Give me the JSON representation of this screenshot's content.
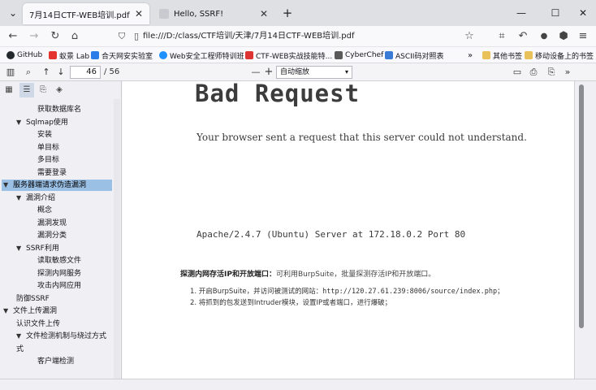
{
  "tabs": [
    {
      "title": "7月14日CTF-WEB培训.pdf",
      "active": true
    },
    {
      "title": "Hello, SSRF!",
      "active": false
    }
  ],
  "new_tab": "+",
  "window_controls": {
    "minimize": "—",
    "maximize": "☐",
    "close": "✕",
    "list": "⌄"
  },
  "navbar": {
    "url": "file:///D:/class/CTF培训/天津/7月14日CTF-WEB培训.pdf"
  },
  "bookmarks": [
    {
      "label": "GitHub",
      "icon": "github-icon",
      "color": "#24292e"
    },
    {
      "label": "蚁景 Lab",
      "icon": "ant-icon",
      "color": "#e3342f"
    },
    {
      "label": "合天网安实验室",
      "icon": "hetian-icon",
      "color": "#2b7de9"
    },
    {
      "label": "Web安全工程师特训班",
      "icon": "web-icon",
      "color": "#1e90ff"
    },
    {
      "label": "CTF-WEB实战技能特...",
      "icon": "ctf-icon",
      "color": "#d33"
    },
    {
      "label": "CyberChef",
      "icon": "chef-icon",
      "color": "#5a5a5a"
    },
    {
      "label": "ASCII码对照表",
      "icon": "ascii-icon",
      "color": "#3a7bd5"
    }
  ],
  "bookmarks_right": [
    {
      "label": "其他书签",
      "icon": "folder-icon"
    },
    {
      "label": "移动设备上的书签",
      "icon": "mobile-icon"
    }
  ],
  "pdf_toolbar": {
    "page_current": "46",
    "page_total": "/ 56",
    "zoom_label": "自动缩放",
    "minus": "—",
    "plus": "+"
  },
  "outline": [
    {
      "label": "获取数据库名",
      "level": 3,
      "twisty": ""
    },
    {
      "label": "Sqlmap使用",
      "level": 2,
      "twisty": "▼"
    },
    {
      "label": "安装",
      "level": 3,
      "twisty": ""
    },
    {
      "label": "单目标",
      "level": 3,
      "twisty": ""
    },
    {
      "label": "多目标",
      "level": 3,
      "twisty": ""
    },
    {
      "label": "需要登录",
      "level": 3,
      "twisty": ""
    },
    {
      "label": "服务器端请求伪造漏洞",
      "level": 1,
      "twisty": "▼",
      "selected": true
    },
    {
      "label": "漏洞介绍",
      "level": 2,
      "twisty": "▼"
    },
    {
      "label": "概念",
      "level": 3,
      "twisty": ""
    },
    {
      "label": "漏洞发现",
      "level": 3,
      "twisty": ""
    },
    {
      "label": "漏洞分类",
      "level": 3,
      "twisty": ""
    },
    {
      "label": "SSRF利用",
      "level": 2,
      "twisty": "▼"
    },
    {
      "label": "读取敏感文件",
      "level": 3,
      "twisty": ""
    },
    {
      "label": "探测内网服务",
      "level": 3,
      "twisty": ""
    },
    {
      "label": "攻击内网应用",
      "level": 3,
      "twisty": ""
    },
    {
      "label": "防御SSRF",
      "level": 2,
      "twisty": ""
    },
    {
      "label": "文件上传漏洞",
      "level": 1,
      "twisty": "▼"
    },
    {
      "label": "认识文件上传",
      "level": 2,
      "twisty": ""
    },
    {
      "label": "文件检测机制与绕过方式",
      "level": 2,
      "twisty": "▼"
    },
    {
      "label": "式",
      "level": 2,
      "twisty": ""
    },
    {
      "label": "客户端检测",
      "level": 3,
      "twisty": ""
    }
  ],
  "content": {
    "heading": "Bad Request",
    "message": "Your browser sent a request that this server could not understand.",
    "server_line": "Apache/2.4.7 (Ubuntu) Server at 172.18.0.2 Port 80",
    "probe_title": "探测内网存活IP和开放端口：",
    "probe_desc": "可利用BurpSuite，批量探测存活IP和开放端口。",
    "step1_prefix": "1. 开启BurpSuite，并访问被测试的网站：",
    "step1_url": "http://120.27.61.239:8006/source/index.php",
    "step1_suffix": "；",
    "step2": "2. 将抓到的包发送到Intruder模块，设置IP或者端口，进行爆破；"
  }
}
